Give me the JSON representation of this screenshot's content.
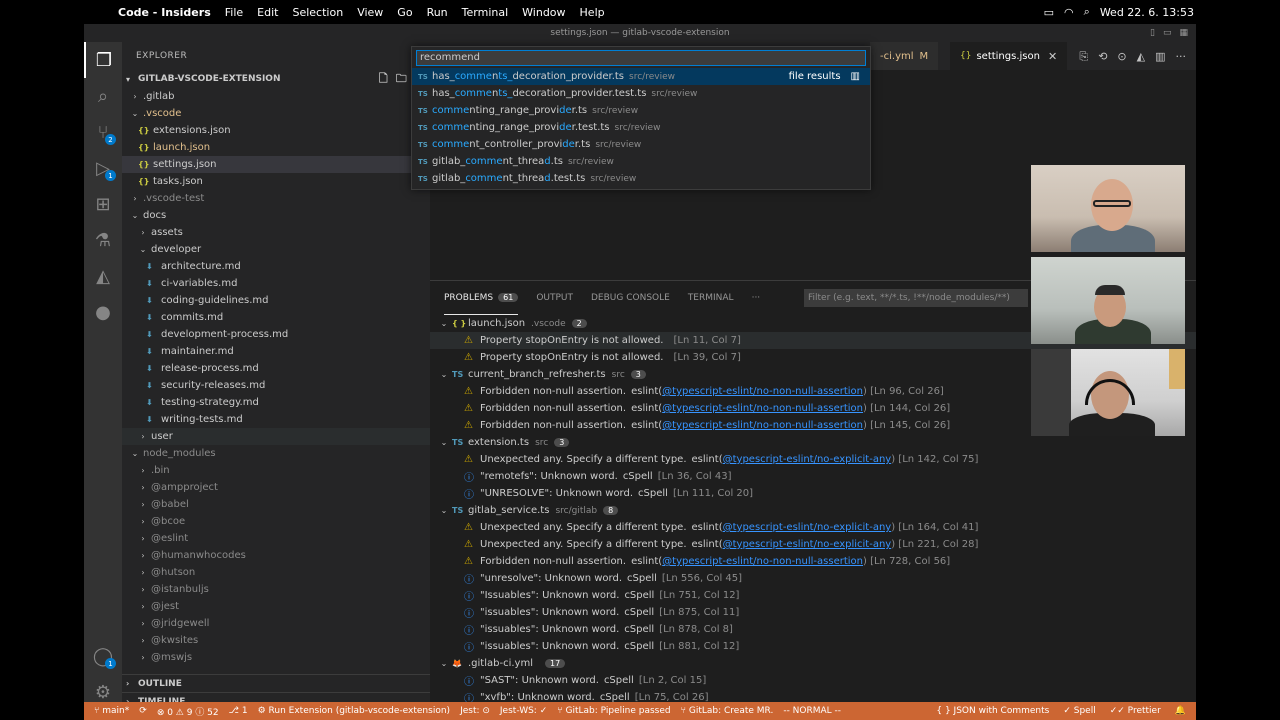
{
  "menubar": {
    "app": "Code - Insiders",
    "menus": [
      "File",
      "Edit",
      "Selection",
      "View",
      "Go",
      "Run",
      "Terminal",
      "Window",
      "Help"
    ],
    "datetime": "Wed 22. 6.  13:53"
  },
  "window": {
    "title": "settings.json — gitlab-vscode-extension"
  },
  "activity": {
    "scm_badge": "2",
    "run_badge": "1",
    "account_badge": "1"
  },
  "sidebar": {
    "header": "EXPLORER",
    "root": "GITLAB-VSCODE-EXTENSION",
    "items": [
      {
        "label": ".gitlab"
      },
      {
        "label": ".vscode"
      },
      {
        "label": "extensions.json"
      },
      {
        "label": "launch.json"
      },
      {
        "label": "settings.json"
      },
      {
        "label": "tasks.json"
      },
      {
        "label": ".vscode-test"
      },
      {
        "label": "docs"
      },
      {
        "label": "assets"
      },
      {
        "label": "developer"
      },
      {
        "label": "architecture.md"
      },
      {
        "label": "ci-variables.md"
      },
      {
        "label": "coding-guidelines.md"
      },
      {
        "label": "commits.md"
      },
      {
        "label": "development-process.md"
      },
      {
        "label": "maintainer.md"
      },
      {
        "label": "release-process.md"
      },
      {
        "label": "security-releases.md"
      },
      {
        "label": "testing-strategy.md"
      },
      {
        "label": "writing-tests.md"
      },
      {
        "label": "user"
      },
      {
        "label": "node_modules"
      },
      {
        "label": ".bin"
      },
      {
        "label": "@ampproject"
      },
      {
        "label": "@babel"
      },
      {
        "label": "@bcoe"
      },
      {
        "label": "@eslint"
      },
      {
        "label": "@humanwhocodes"
      },
      {
        "label": "@hutson"
      },
      {
        "label": "@istanbuljs"
      },
      {
        "label": "@jest"
      },
      {
        "label": "@jridgewell"
      },
      {
        "label": "@kwsites"
      },
      {
        "label": "@mswjs"
      }
    ],
    "outline": "OUTLINE",
    "timeline": "TIMELINE"
  },
  "tabs": {
    "inactive": {
      "label": "-ci.yml",
      "status": "M"
    },
    "active": {
      "label": "settings.json"
    }
  },
  "quickopen": {
    "value": "recommend",
    "file_results": "file results",
    "results": [
      {
        "pre": "has_",
        "hl1": "comme",
        "mid1": "n",
        "hl2": "ts_",
        "mid2": "d",
        "post": "ecoration_provider.ts",
        "desc": "src/review"
      },
      {
        "pre": "has_",
        "hl1": "comme",
        "mid1": "n",
        "hl2": "ts_",
        "mid2": "d",
        "post": "ecoration_provider.test.ts",
        "desc": "src/review"
      },
      {
        "pre": "",
        "hl1": "comme",
        "mid1": "nting_range_provi",
        "hl2": "de",
        "mid2": "",
        "post": "r.ts",
        "desc": "src/review"
      },
      {
        "pre": "",
        "hl1": "comme",
        "mid1": "nting_range_provi",
        "hl2": "de",
        "mid2": "",
        "post": "r.test.ts",
        "desc": "src/review"
      },
      {
        "pre": "",
        "hl1": "comme",
        "mid1": "nt_controller_provi",
        "hl2": "de",
        "mid2": "",
        "post": "r.ts",
        "desc": "src/review"
      },
      {
        "pre": "gitlab_",
        "hl1": "comme",
        "mid1": "nt_threa",
        "hl2": "d",
        "mid2": "",
        "post": ".ts",
        "desc": "src/review"
      },
      {
        "pre": "gitlab_",
        "hl1": "comme",
        "mid1": "nt_threa",
        "hl2": "d",
        "mid2": "",
        "post": ".test.ts",
        "desc": "src/review"
      }
    ]
  },
  "panel": {
    "tabs": [
      {
        "label": "PROBLEMS",
        "count": "61"
      },
      {
        "label": "OUTPUT"
      },
      {
        "label": "DEBUG CONSOLE"
      },
      {
        "label": "TERMINAL"
      },
      {
        "label": "···"
      }
    ],
    "filter_placeholder": "Filter (e.g. text, **/*.ts, !**/node_modules/**)",
    "groups": [
      {
        "icon": "{ }",
        "file": "launch.json",
        "path": ".vscode",
        "count": "2",
        "problems": [
          {
            "sev": "warn",
            "msg": "Property stopOnEntry is not allowed.",
            "src": "",
            "rule": "",
            "loc": "[Ln 11, Col 7]"
          },
          {
            "sev": "warn",
            "msg": "Property stopOnEntry is not allowed.",
            "src": "",
            "rule": "",
            "loc": "[Ln 39, Col 7]"
          }
        ]
      },
      {
        "icon": "TS",
        "file": "current_branch_refresher.ts",
        "path": "src",
        "count": "3",
        "problems": [
          {
            "sev": "warn",
            "msg": "Forbidden non-null assertion.",
            "src": "eslint(",
            "rule": "@typescript-eslint/no-non-null-assertion",
            "loc": ")  [Ln 96, Col 26]"
          },
          {
            "sev": "warn",
            "msg": "Forbidden non-null assertion.",
            "src": "eslint(",
            "rule": "@typescript-eslint/no-non-null-assertion",
            "loc": ")  [Ln 144, Col 26]"
          },
          {
            "sev": "warn",
            "msg": "Forbidden non-null assertion.",
            "src": "eslint(",
            "rule": "@typescript-eslint/no-non-null-assertion",
            "loc": ")  [Ln 145, Col 26]"
          }
        ]
      },
      {
        "icon": "TS",
        "file": "extension.ts",
        "path": "src",
        "count": "3",
        "problems": [
          {
            "sev": "warn",
            "msg": "Unexpected any. Specify a different type.",
            "src": "eslint(",
            "rule": "@typescript-eslint/no-explicit-any",
            "loc": ")  [Ln 142, Col 75]"
          },
          {
            "sev": "info",
            "msg": "\"remotefs\": Unknown word.",
            "src": "cSpell",
            "rule": "",
            "loc": "[Ln 36, Col 43]"
          },
          {
            "sev": "info",
            "msg": "\"UNRESOLVE\": Unknown word.",
            "src": "cSpell",
            "rule": "",
            "loc": "[Ln 111, Col 20]"
          }
        ]
      },
      {
        "icon": "TS",
        "file": "gitlab_service.ts",
        "path": "src/gitlab",
        "count": "8",
        "problems": [
          {
            "sev": "warn",
            "msg": "Unexpected any. Specify a different type.",
            "src": "eslint(",
            "rule": "@typescript-eslint/no-explicit-any",
            "loc": ")  [Ln 164, Col 41]"
          },
          {
            "sev": "warn",
            "msg": "Unexpected any. Specify a different type.",
            "src": "eslint(",
            "rule": "@typescript-eslint/no-explicit-any",
            "loc": ")  [Ln 221, Col 28]"
          },
          {
            "sev": "warn",
            "msg": "Forbidden non-null assertion.",
            "src": "eslint(",
            "rule": "@typescript-eslint/no-non-null-assertion",
            "loc": ")  [Ln 728, Col 56]"
          },
          {
            "sev": "info",
            "msg": "\"unresolve\": Unknown word.",
            "src": "cSpell",
            "rule": "",
            "loc": "[Ln 556, Col 45]"
          },
          {
            "sev": "info",
            "msg": "\"Issuables\": Unknown word.",
            "src": "cSpell",
            "rule": "",
            "loc": "[Ln 751, Col 12]"
          },
          {
            "sev": "info",
            "msg": "\"issuables\": Unknown word.",
            "src": "cSpell",
            "rule": "",
            "loc": "[Ln 875, Col 11]"
          },
          {
            "sev": "info",
            "msg": "\"issuables\": Unknown word.",
            "src": "cSpell",
            "rule": "",
            "loc": "[Ln 878, Col 8]"
          },
          {
            "sev": "info",
            "msg": "\"issuables\": Unknown word.",
            "src": "cSpell",
            "rule": "",
            "loc": "[Ln 881, Col 12]"
          }
        ]
      },
      {
        "icon": "🦊",
        "file": ".gitlab-ci.yml",
        "path": "",
        "count": "17",
        "problems": [
          {
            "sev": "info",
            "msg": "\"SAST\": Unknown word.",
            "src": "cSpell",
            "rule": "",
            "loc": "[Ln 2, Col 15]"
          },
          {
            "sev": "info",
            "msg": "\"xvfb\": Unknown word.",
            "src": "cSpell",
            "rule": "",
            "loc": "[Ln 75, Col 26]"
          }
        ]
      }
    ]
  },
  "statusbar": {
    "branch": "main*",
    "problems": "⊗ 0 ⚠ 9 ⓘ 52",
    "ports": "1",
    "run": "Run Extension (gitlab-vscode-extension)",
    "jest": "Jest: ⊙",
    "jest_ws": "Jest-WS: ✓",
    "pipeline": "GitLab: Pipeline passed",
    "mr": "GitLab: Create MR.",
    "vim_mode": "-- NORMAL --",
    "language": "JSON with Comments",
    "spell": "Spell",
    "prettier": "Prettier"
  },
  "colors": {
    "statusbar": "#cc6633",
    "accent": "#007acc",
    "warning": "#cca700",
    "info": "#3794ff"
  }
}
